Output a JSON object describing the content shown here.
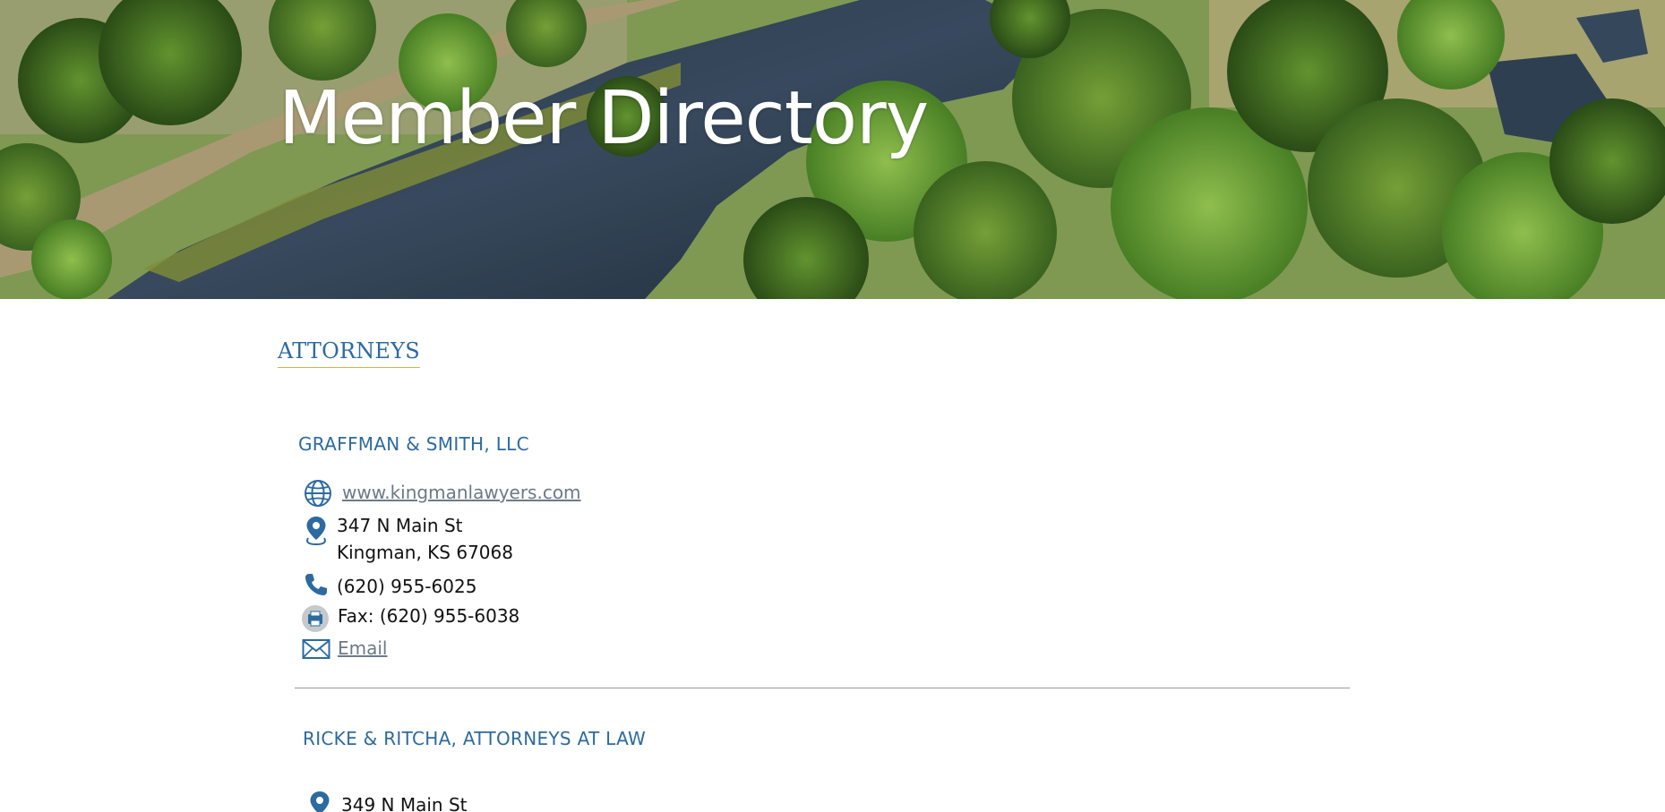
{
  "hero": {
    "title": "Member Directory"
  },
  "section": {
    "heading": "ATTORNEYS"
  },
  "companies": [
    {
      "name": "GRAFFMAN & SMITH, LLC",
      "website": "www.kingmanlawyers.com",
      "address_line1": "347 N Main St",
      "address_line2": "Kingman, KS 67068",
      "phone": "(620) 955-6025",
      "fax": "Fax: (620) 955-6038",
      "email_label": "Email"
    },
    {
      "name": "RICKE & RITCHA, ATTORNEYS AT LAW",
      "address_line1": "349 N Main St"
    }
  ],
  "icons": {
    "website": "globe-icon",
    "address": "map-pin-icon",
    "phone": "phone-icon",
    "fax": "fax-icon",
    "email": "envelope-icon"
  },
  "colors": {
    "accent": "#2c6aa0",
    "heading_underline": "#d8b04c",
    "link": "#6b7a88",
    "text": "#111111"
  }
}
